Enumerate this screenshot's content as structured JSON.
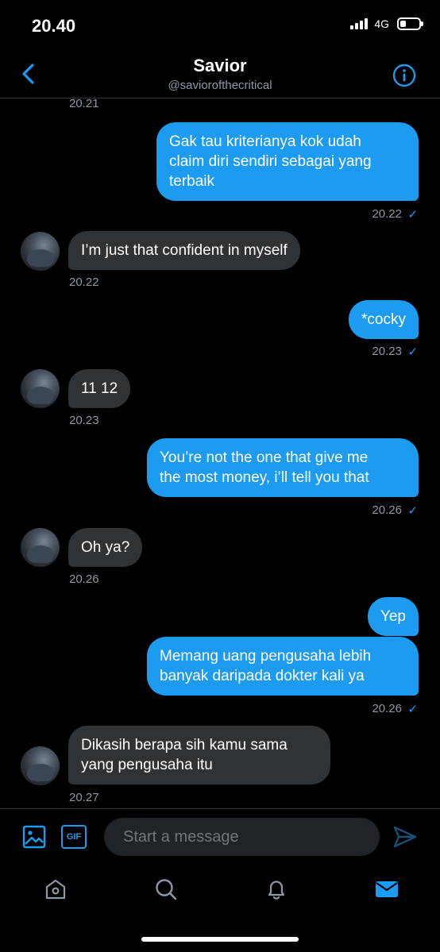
{
  "status_bar": {
    "time": "20.40",
    "network": "4G",
    "battery_level": 0.3
  },
  "header": {
    "name": "Savior",
    "handle": "@saviorofthecritical"
  },
  "messages": [
    {
      "direction": "in",
      "timestamp": "20.21"
    },
    {
      "direction": "out",
      "lines": [
        "Gak tau kriterianya kok udah",
        "claim diri sendiri sebagai yang",
        "terbaik"
      ],
      "timestamp": "20.22",
      "read": "✓"
    },
    {
      "direction": "in",
      "lines": [
        "I’m just that confident in myself"
      ],
      "timestamp": "20.22"
    },
    {
      "direction": "out",
      "lines": [
        "*cocky"
      ],
      "timestamp": "20.23",
      "read": "✓"
    },
    {
      "direction": "in",
      "lines": [
        "11 12"
      ],
      "timestamp": "20.23"
    },
    {
      "direction": "out",
      "lines": [
        "You’re not the one that give me",
        "the most money, i’ll tell you that"
      ],
      "timestamp": "20.26",
      "read": "✓"
    },
    {
      "direction": "in",
      "lines": [
        "Oh ya?"
      ],
      "timestamp": "20.26"
    },
    {
      "direction": "out",
      "lines": [
        "Yep"
      ]
    },
    {
      "direction": "out",
      "lines": [
        "Memang uang pengusaha lebih",
        "banyak daripada dokter kali ya"
      ],
      "timestamp": "20.26",
      "read": "✓"
    },
    {
      "direction": "in",
      "lines": [
        "Dikasih berapa sih kamu sama",
        "yang pengusaha itu"
      ],
      "timestamp": "20.27"
    }
  ],
  "composer": {
    "placeholder": "Start a message",
    "gif_label": "GIF"
  },
  "tabbar": {
    "items": [
      "home-icon",
      "search-icon",
      "notifications-icon",
      "messages-icon"
    ],
    "active": "messages-icon"
  },
  "colors": {
    "accent": "#1d9bf0",
    "incoming_bubble": "#2f3336",
    "background": "#000000",
    "muted_text": "#8b98a5"
  }
}
